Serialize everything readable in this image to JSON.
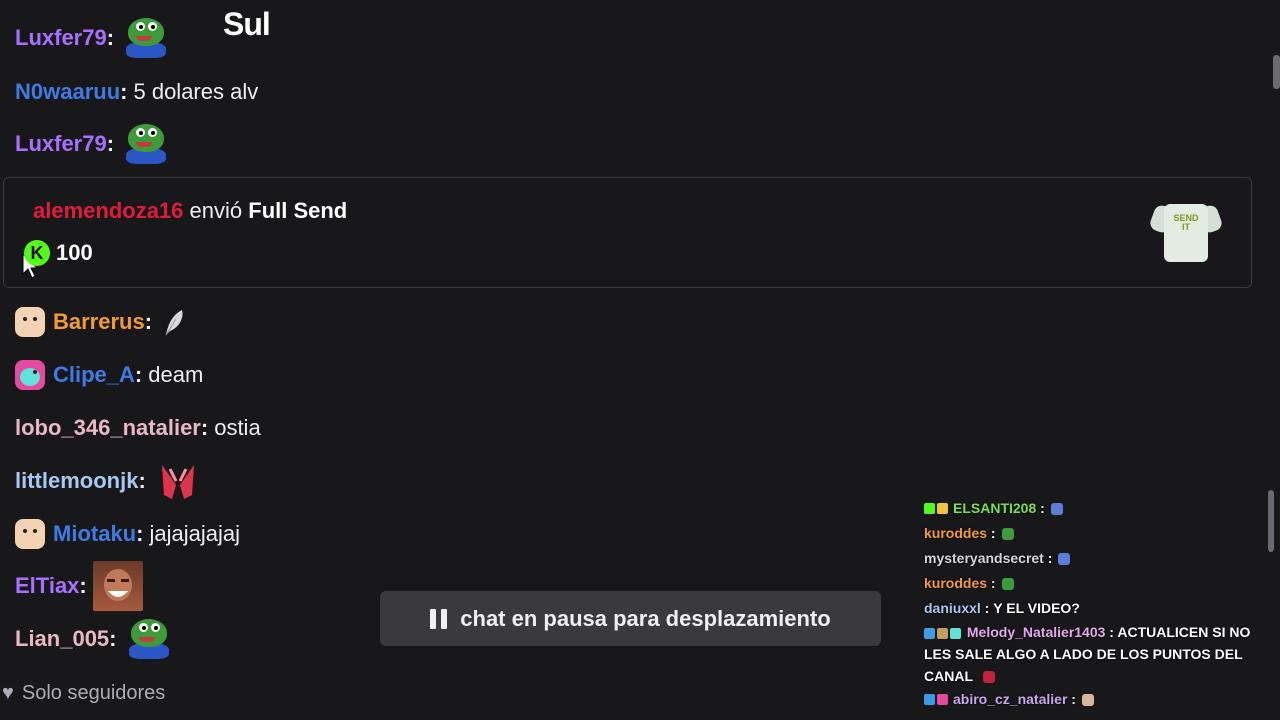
{
  "stream_overlay_text": "Sul",
  "chat": {
    "messages": [
      {
        "user": "Luxfer79",
        "color": "#a970ff",
        "text": "",
        "emote": "pepe-frog"
      },
      {
        "user": "N0waaruu",
        "color": "#3e7ce4",
        "text": "5 dolares alv"
      },
      {
        "user": "Luxfer79",
        "color": "#a970ff",
        "text": "",
        "emote": "pepe-frog"
      },
      {
        "user": "Barrerus",
        "color": "#f39c33",
        "text": "",
        "emote": "feather"
      },
      {
        "user": "Clipe_A",
        "color": "#3e7ce4",
        "text": "deam"
      },
      {
        "user": "lobo_346_natalier",
        "color": "#e7b9c3",
        "text": "ostia"
      },
      {
        "user": "littlemoonjk",
        "color": "#a9c8ef",
        "text": "",
        "emote": "praying-hands"
      },
      {
        "user": "Miotaku",
        "color": "#3e7ce4",
        "text": "jajajajajaj"
      },
      {
        "user": "ElTiax",
        "color": "#a970ff",
        "text": "",
        "emote": "laughing-face"
      },
      {
        "user": "Lian_005",
        "color": "#e7b9c3",
        "text": "",
        "emote": "pepe-frog"
      }
    ],
    "gift": {
      "user": "alemendoza16",
      "verb": "envió",
      "item": "Full Send",
      "amount": "100",
      "coin_label": "K",
      "shirt_print": "SEND IT"
    },
    "paused_label": "chat en pausa para desplazamiento",
    "mode_label": "Solo seguidores"
  },
  "overlay_chat": [
    {
      "user": "ELSANTI208",
      "color": "#7be04e",
      "text": ""
    },
    {
      "user": "kuroddes",
      "color": "#f39c33",
      "text": ""
    },
    {
      "user": "mysteryandsecret",
      "color": "#d6d6d6",
      "text": ""
    },
    {
      "user": "kuroddes",
      "color": "#f39c33",
      "text": ""
    },
    {
      "user": "daniuxxl",
      "color": "#a9c8ef",
      "text": "Y EL VIDEO?"
    },
    {
      "user": "Melody_Natalier1403",
      "color": "#e6a6f0",
      "text": "ACTUALICEN SI NO LES SALE ALGO A LADO DE LOS PUNTOS DEL CANAL"
    },
    {
      "user": "abiro_cz_natalier",
      "color": "#c9a6f0",
      "text": ""
    }
  ]
}
